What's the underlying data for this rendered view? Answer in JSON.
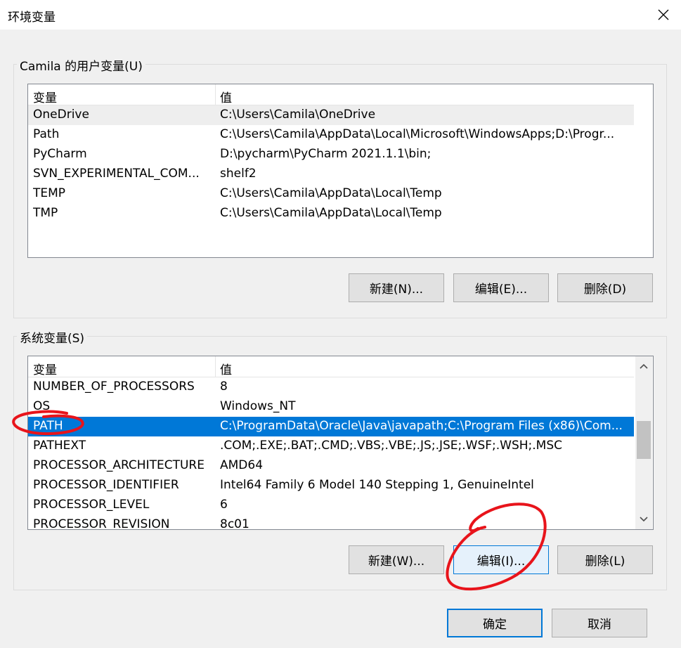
{
  "window": {
    "title": "环境变量",
    "close_icon": "close-icon"
  },
  "user_vars": {
    "group_label": "Camila 的用户变量(U)",
    "col_name": "变量",
    "col_value": "值",
    "rows": [
      {
        "name": "OneDrive",
        "value": "C:\\Users\\Camila\\OneDrive"
      },
      {
        "name": "Path",
        "value": "C:\\Users\\Camila\\AppData\\Local\\Microsoft\\WindowsApps;D:\\Progr..."
      },
      {
        "name": "PyCharm",
        "value": "D:\\pycharm\\PyCharm 2021.1.1\\bin;"
      },
      {
        "name": "SVN_EXPERIMENTAL_COM...",
        "value": "shelf2"
      },
      {
        "name": "TEMP",
        "value": "C:\\Users\\Camila\\AppData\\Local\\Temp"
      },
      {
        "name": "TMP",
        "value": "C:\\Users\\Camila\\AppData\\Local\\Temp"
      }
    ],
    "buttons": {
      "new": "新建(N)...",
      "edit": "编辑(E)...",
      "delete": "删除(D)"
    }
  },
  "system_vars": {
    "group_label": "系统变量(S)",
    "col_name": "变量",
    "col_value": "值",
    "rows": [
      {
        "name": "NUMBER_OF_PROCESSORS",
        "value": "8"
      },
      {
        "name": "OS",
        "value": "Windows_NT"
      },
      {
        "name": "PATH",
        "value": "C:\\ProgramData\\Oracle\\Java\\javapath;C:\\Program Files (x86)\\Com..."
      },
      {
        "name": "PATHEXT",
        "value": ".COM;.EXE;.BAT;.CMD;.VBS;.VBE;.JS;.JSE;.WSF;.WSH;.MSC"
      },
      {
        "name": "PROCESSOR_ARCHITECTURE",
        "value": "AMD64"
      },
      {
        "name": "PROCESSOR_IDENTIFIER",
        "value": "Intel64 Family 6 Model 140 Stepping 1, GenuineIntel"
      },
      {
        "name": "PROCESSOR_LEVEL",
        "value": "6"
      },
      {
        "name": "PROCESSOR_REVISION",
        "value": "8c01"
      }
    ],
    "selected_row": "PATH",
    "buttons": {
      "new": "新建(W)...",
      "edit": "编辑(I)...",
      "delete": "删除(L)"
    }
  },
  "footer": {
    "ok": "确定",
    "cancel": "取消"
  },
  "colors": {
    "selection": "#0078d7",
    "annotation": "#e8141b"
  }
}
